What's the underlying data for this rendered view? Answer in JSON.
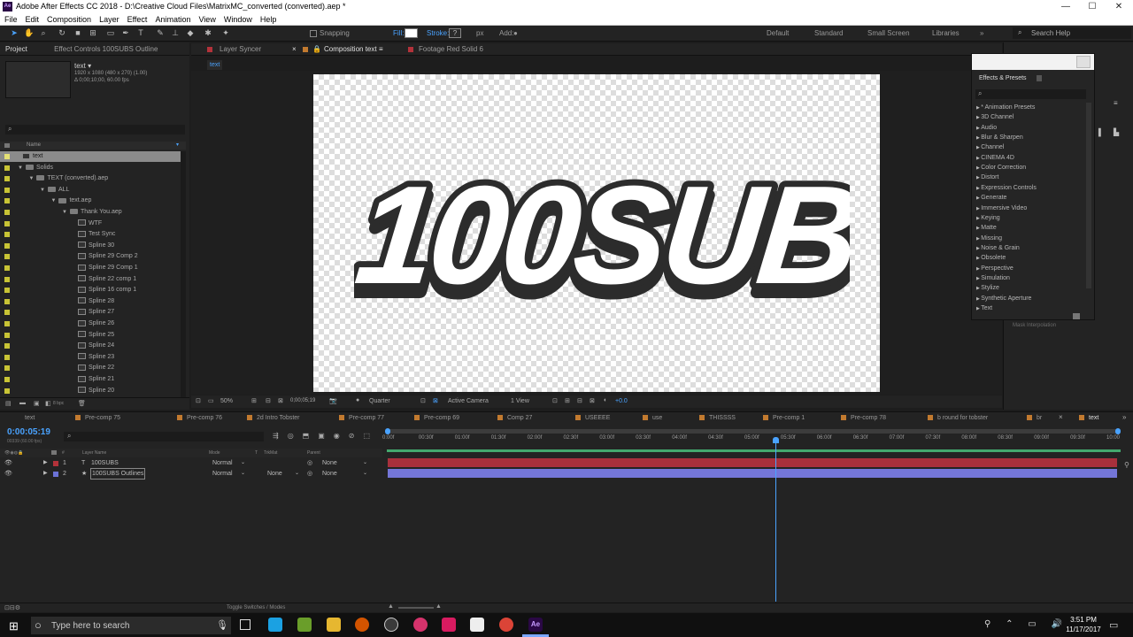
{
  "window": {
    "title": "Adobe After Effects CC 2018 - D:\\Creative Cloud Files\\MatrixMC_converted (converted).aep *",
    "app_icon": "Ae",
    "minimize": "—",
    "maximize": "☐",
    "close": "✕"
  },
  "menu": [
    "File",
    "Edit",
    "Composition",
    "Layer",
    "Effect",
    "Animation",
    "View",
    "Window",
    "Help"
  ],
  "toolbar": {
    "snapping": "Snapping",
    "fill": "Fill:",
    "stroke": "Stroke:",
    "stroke_px": "px",
    "add": "Add:",
    "workspaces": [
      "Default",
      "Standard",
      "Small Screen",
      "Libraries"
    ],
    "search_help": "Search Help"
  },
  "project_panel": {
    "tabs": [
      "Project",
      "Effect Controls 100SUBS Outline"
    ],
    "selected_name": "text ▾",
    "selected_info1": "1920 x 1080 (480 x 270) (1.00)",
    "selected_info2": "Δ 0;00;10;00, 60.00 fps",
    "search_placeholder": "",
    "col_name": "Name",
    "bpc": "8 bpc",
    "items": [
      {
        "label": "text",
        "type": "comp",
        "depth": 0
      },
      {
        "label": "Solids",
        "type": "folder",
        "depth": 0
      },
      {
        "label": "TEXT (converted).aep",
        "type": "folder",
        "depth": 1
      },
      {
        "label": "ALL",
        "type": "folder",
        "depth": 2
      },
      {
        "label": "text.aep",
        "type": "folder",
        "depth": 3
      },
      {
        "label": "Thank You.aep",
        "type": "folder",
        "depth": 4
      },
      {
        "label": "WTF",
        "type": "comp",
        "depth": 5
      },
      {
        "label": "Test Sync",
        "type": "comp",
        "depth": 5
      },
      {
        "label": "Spline 30",
        "type": "comp",
        "depth": 5
      },
      {
        "label": "Spline 29 Comp 2",
        "type": "comp",
        "depth": 5
      },
      {
        "label": "Spline 29 Comp 1",
        "type": "comp",
        "depth": 5
      },
      {
        "label": "Spline 22 comp 1",
        "type": "comp",
        "depth": 5
      },
      {
        "label": "Spline 16 comp 1",
        "type": "comp",
        "depth": 5
      },
      {
        "label": "Spline 28",
        "type": "comp",
        "depth": 5
      },
      {
        "label": "Spline 27",
        "type": "comp",
        "depth": 5
      },
      {
        "label": "Spline 26",
        "type": "comp",
        "depth": 5
      },
      {
        "label": "Spline 25",
        "type": "comp",
        "depth": 5
      },
      {
        "label": "Spline 24",
        "type": "comp",
        "depth": 5
      },
      {
        "label": "Spline 23",
        "type": "comp",
        "depth": 5
      },
      {
        "label": "Spline 22",
        "type": "comp",
        "depth": 5
      },
      {
        "label": "Spline 21",
        "type": "comp",
        "depth": 5
      },
      {
        "label": "Spline 20",
        "type": "comp",
        "depth": 5
      }
    ]
  },
  "viewer": {
    "tabs": [
      "Layer Syncer",
      "Composition text",
      "Footage Red Solid 6"
    ],
    "breadcrumb": "text",
    "comp_text": "100SUBS",
    "zoom": "50%",
    "timecode": "0;00;05;19",
    "resolution": "Quarter",
    "camera": "Active Camera",
    "views": "1 View",
    "exposure": "+0.0"
  },
  "effects_presets": {
    "title": "Effects & Presets",
    "items": [
      "* Animation Presets",
      "3D Channel",
      "Audio",
      "Blur & Sharpen",
      "Channel",
      "CINEMA 4D",
      "Color Correction",
      "Distort",
      "Expression Controls",
      "Generate",
      "Immersive Video",
      "Keying",
      "Matte",
      "Missing",
      "Noise & Grain",
      "Obsolete",
      "Perspective",
      "Simulation",
      "Stylize",
      "Synthetic Aperture",
      "Text"
    ],
    "behind_label": "Mask Interpolation"
  },
  "timeline": {
    "comp_tabs": [
      "text",
      "Pre-comp 75",
      "Pre-comp 76",
      "2d Intro Tobster",
      "Pre-comp 77",
      "Pre-comp 69",
      "Comp 27",
      "USEEEE",
      "use",
      "THISSSS",
      "Pre-comp 1",
      "Pre-comp 78",
      "b round for tobster",
      "br",
      "text"
    ],
    "current_time": "0:00:05:19",
    "fps_info": "00339 (60.00 fps)",
    "columns": {
      "name": "Layer Name",
      "mode": "Mode",
      "t": "T",
      "trkmat": "TrkMat",
      "parent": "Parent"
    },
    "ruler": [
      "0:00f",
      "00:30f",
      "01:00f",
      "01:30f",
      "02:00f",
      "02:30f",
      "03:00f",
      "03:30f",
      "04:00f",
      "04:30f",
      "05:00f",
      "05:30f",
      "06:00f",
      "06:30f",
      "07:00f",
      "07:30f",
      "08:00f",
      "08:30f",
      "09:00f",
      "09:30f",
      "10:00"
    ],
    "layers": [
      {
        "num": "1",
        "name": "100SUBS",
        "mode": "Normal",
        "trkmat": "",
        "parent": "None",
        "color": "#b3323a",
        "bar": "#a8303c"
      },
      {
        "num": "2",
        "name": "100SUBS Outlines",
        "mode": "Normal",
        "trkmat": "None",
        "parent": "None",
        "color": "#6b72d6",
        "bar": "#7476d8"
      }
    ],
    "toggle_label": "Toggle Switches / Modes"
  },
  "taskbar": {
    "search_placeholder": "Type here to search",
    "time": "3:51 PM",
    "date": "11/17/2017"
  }
}
